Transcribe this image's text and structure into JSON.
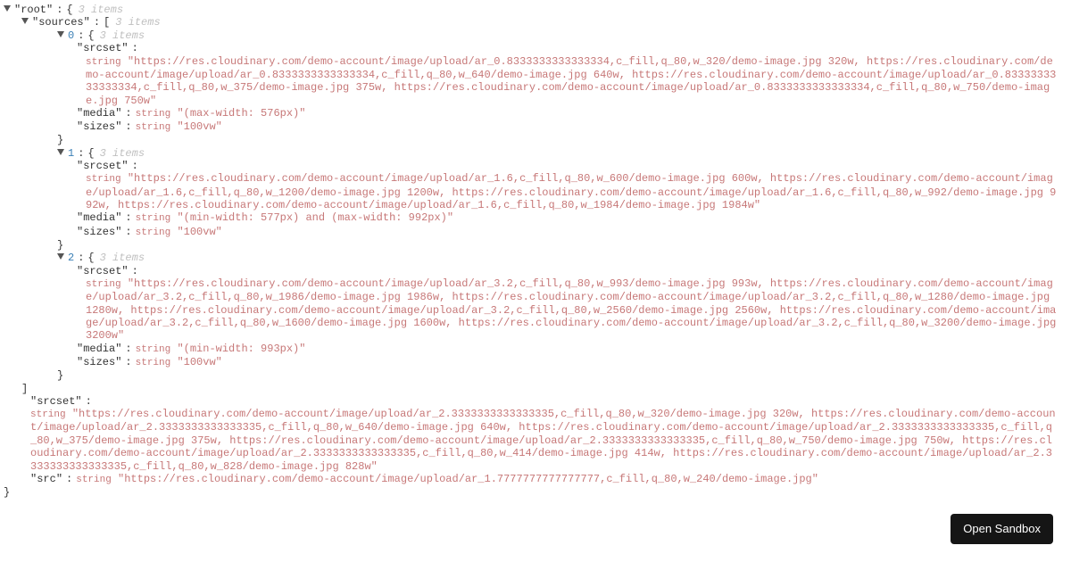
{
  "meta": {
    "items3": "3 items",
    "typeString": "string"
  },
  "root": {
    "label": "root",
    "sourcesLabel": "sources",
    "srcsetLabel": "srcset",
    "mediaLabel": "media",
    "sizesLabel": "sizes",
    "srcLabel": "src"
  },
  "s0": {
    "idx": "0",
    "srcset": "\"https://res.cloudinary.com/demo-account/image/upload/ar_0.8333333333333334,c_fill,q_80,w_320/demo-image.jpg 320w, https://res.cloudinary.com/demo-account/image/upload/ar_0.8333333333333334,c_fill,q_80,w_640/demo-image.jpg 640w, https://res.cloudinary.com/demo-account/image/upload/ar_0.8333333333333334,c_fill,q_80,w_375/demo-image.jpg 375w, https://res.cloudinary.com/demo-account/image/upload/ar_0.8333333333333334,c_fill,q_80,w_750/demo-image.jpg 750w\"",
    "media": "\"(max-width: 576px)\"",
    "sizes": "\"100vw\""
  },
  "s1": {
    "idx": "1",
    "srcset": "\"https://res.cloudinary.com/demo-account/image/upload/ar_1.6,c_fill,q_80,w_600/demo-image.jpg 600w, https://res.cloudinary.com/demo-account/image/upload/ar_1.6,c_fill,q_80,w_1200/demo-image.jpg 1200w, https://res.cloudinary.com/demo-account/image/upload/ar_1.6,c_fill,q_80,w_992/demo-image.jpg 992w, https://res.cloudinary.com/demo-account/image/upload/ar_1.6,c_fill,q_80,w_1984/demo-image.jpg 1984w\"",
    "media": "\"(min-width: 577px) and (max-width: 992px)\"",
    "sizes": "\"100vw\""
  },
  "s2": {
    "idx": "2",
    "srcset": "\"https://res.cloudinary.com/demo-account/image/upload/ar_3.2,c_fill,q_80,w_993/demo-image.jpg 993w, https://res.cloudinary.com/demo-account/image/upload/ar_3.2,c_fill,q_80,w_1986/demo-image.jpg 1986w, https://res.cloudinary.com/demo-account/image/upload/ar_3.2,c_fill,q_80,w_1280/demo-image.jpg 1280w, https://res.cloudinary.com/demo-account/image/upload/ar_3.2,c_fill,q_80,w_2560/demo-image.jpg 2560w, https://res.cloudinary.com/demo-account/image/upload/ar_3.2,c_fill,q_80,w_1600/demo-image.jpg 1600w, https://res.cloudinary.com/demo-account/image/upload/ar_3.2,c_fill,q_80,w_3200/demo-image.jpg 3200w\"",
    "media": "\"(min-width: 993px)\"",
    "sizes": "\"100vw\""
  },
  "rootSrcset": "\"https://res.cloudinary.com/demo-account/image/upload/ar_2.3333333333333335,c_fill,q_80,w_320/demo-image.jpg 320w, https://res.cloudinary.com/demo-account/image/upload/ar_2.3333333333333335,c_fill,q_80,w_640/demo-image.jpg 640w, https://res.cloudinary.com/demo-account/image/upload/ar_2.3333333333333335,c_fill,q_80,w_375/demo-image.jpg 375w, https://res.cloudinary.com/demo-account/image/upload/ar_2.3333333333333335,c_fill,q_80,w_750/demo-image.jpg 750w, https://res.cloudinary.com/demo-account/image/upload/ar_2.3333333333333335,c_fill,q_80,w_414/demo-image.jpg 414w, https://res.cloudinary.com/demo-account/image/upload/ar_2.3333333333333335,c_fill,q_80,w_828/demo-image.jpg 828w\"",
  "rootSrc": "\"https://res.cloudinary.com/demo-account/image/upload/ar_1.7777777777777777,c_fill,q_80,w_240/demo-image.jpg\"",
  "sandbox": "Open Sandbox"
}
